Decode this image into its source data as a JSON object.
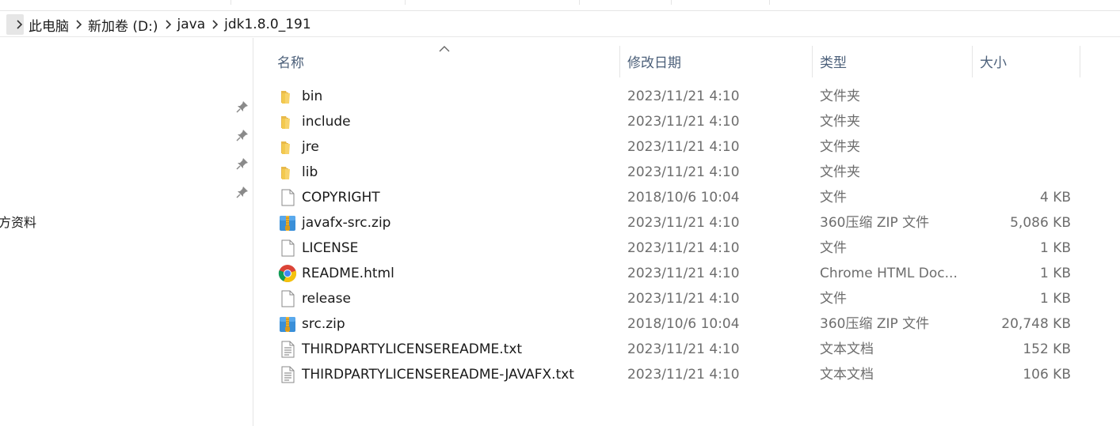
{
  "breadcrumb": {
    "items": [
      "此电脑",
      "新加卷 (D:)",
      "java",
      "jdk1.8.0_191"
    ]
  },
  "nav": {
    "partial_label": "方资料"
  },
  "columns": {
    "name": "名称",
    "date": "修改日期",
    "type": "类型",
    "size": "大小"
  },
  "files": [
    {
      "name": "bin",
      "date": "2023/11/21 4:10",
      "type": "文件夹",
      "size": "",
      "icon": "folder-icon"
    },
    {
      "name": "include",
      "date": "2023/11/21 4:10",
      "type": "文件夹",
      "size": "",
      "icon": "folder-icon"
    },
    {
      "name": "jre",
      "date": "2023/11/21 4:10",
      "type": "文件夹",
      "size": "",
      "icon": "folder-icon"
    },
    {
      "name": "lib",
      "date": "2023/11/21 4:10",
      "type": "文件夹",
      "size": "",
      "icon": "folder-icon"
    },
    {
      "name": "COPYRIGHT",
      "date": "2018/10/6 10:04",
      "type": "文件",
      "size": "4 KB",
      "icon": "file-icon"
    },
    {
      "name": "javafx-src.zip",
      "date": "2023/11/21 4:10",
      "type": "360压缩 ZIP 文件",
      "size": "5,086 KB",
      "icon": "zip-archive-icon"
    },
    {
      "name": "LICENSE",
      "date": "2023/11/21 4:10",
      "type": "文件",
      "size": "1 KB",
      "icon": "file-icon"
    },
    {
      "name": "README.html",
      "date": "2023/11/21 4:10",
      "type": "Chrome HTML Doc...",
      "size": "1 KB",
      "icon": "chrome-icon"
    },
    {
      "name": "release",
      "date": "2023/11/21 4:10",
      "type": "文件",
      "size": "1 KB",
      "icon": "file-icon"
    },
    {
      "name": "src.zip",
      "date": "2018/10/6 10:04",
      "type": "360压缩 ZIP 文件",
      "size": "20,748 KB",
      "icon": "zip-archive-icon"
    },
    {
      "name": "THIRDPARTYLICENSEREADME.txt",
      "date": "2023/11/21 4:10",
      "type": "文本文档",
      "size": "152 KB",
      "icon": "text-document-icon"
    },
    {
      "name": "THIRDPARTYLICENSEREADME-JAVAFX.txt",
      "date": "2023/11/21 4:10",
      "type": "文本文档",
      "size": "106 KB",
      "icon": "text-document-icon"
    }
  ]
}
